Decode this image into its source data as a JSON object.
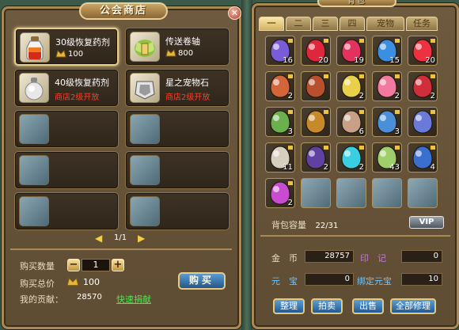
{
  "shop": {
    "title": "公会商店",
    "close": "✕",
    "items": [
      {
        "name": "30级恢复药剂",
        "price": "100",
        "icon": "red-potion-icon",
        "selected": true
      },
      {
        "name": "传送卷轴",
        "price": "800",
        "icon": "teleport-scroll-icon"
      },
      {
        "name": "40级恢复药剂",
        "locked": "商店2级开放",
        "icon": "white-potion-icon"
      },
      {
        "name": "星之宠物石",
        "locked": "商店2级开放",
        "icon": "pet-stone-icon"
      }
    ],
    "pager": {
      "prev": "◀",
      "text": "1/1",
      "next": "▶"
    },
    "qty_label": "购买数量",
    "minus": "−",
    "qty": "1",
    "plus": "+",
    "total_label": "购买总价",
    "total": "100",
    "contrib_label": "我的贡献：",
    "contrib": "28570",
    "quick_donate": "快速捐献",
    "buy": "购买"
  },
  "bag": {
    "title": "背包",
    "tabs": [
      "一",
      "二",
      "三",
      "四",
      "宠物",
      "任务"
    ],
    "active_tab": 0,
    "counts": [
      "16",
      "20",
      "19",
      "15",
      "20",
      "2",
      "",
      "2",
      "2",
      "2",
      "3",
      "",
      "6",
      "3",
      "",
      "11",
      "2",
      "2",
      "43",
      "4",
      "2",
      "",
      "",
      "",
      ""
    ],
    "capacity_label": "背包容量",
    "capacity": "22/31",
    "vip": "VIP",
    "gold_label": "金　币",
    "gold": "28757",
    "seal_label": "印　记",
    "seal": "0",
    "yuanbao_label": "元　宝",
    "yuanbao": "0",
    "bound_label": "绑定元宝",
    "bound": "10",
    "buttons": [
      "整理",
      "拍卖",
      "出售",
      "全部修理"
    ]
  }
}
